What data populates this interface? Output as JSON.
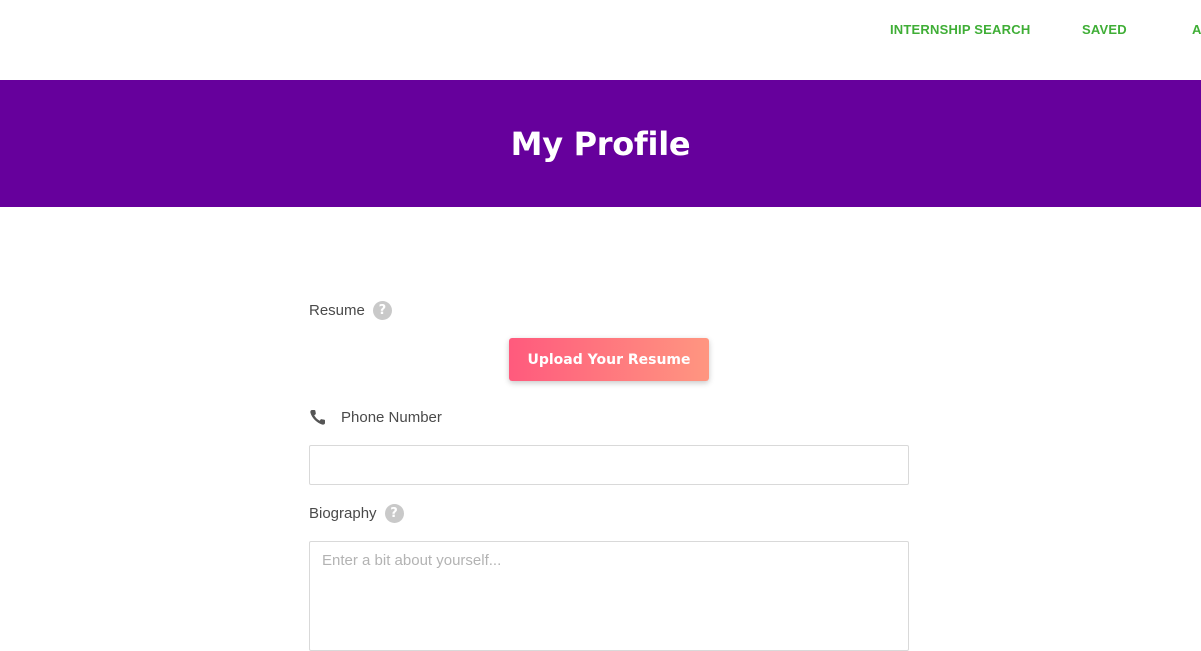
{
  "nav": {
    "items": [
      {
        "label": "INTERNSHIP SEARCH"
      },
      {
        "label": "SAVED"
      },
      {
        "label": "A"
      }
    ],
    "color": "#3fae36"
  },
  "hero": {
    "title": "My Profile",
    "background": "#66009c"
  },
  "form": {
    "resume": {
      "label": "Resume",
      "help_icon": "question-icon",
      "upload_button": "Upload Your Resume"
    },
    "phone": {
      "label": "Phone Number",
      "icon": "phone-icon",
      "value": ""
    },
    "biography": {
      "label": "Biography",
      "help_icon": "question-icon",
      "placeholder": "Enter a bit about yourself..."
    }
  }
}
